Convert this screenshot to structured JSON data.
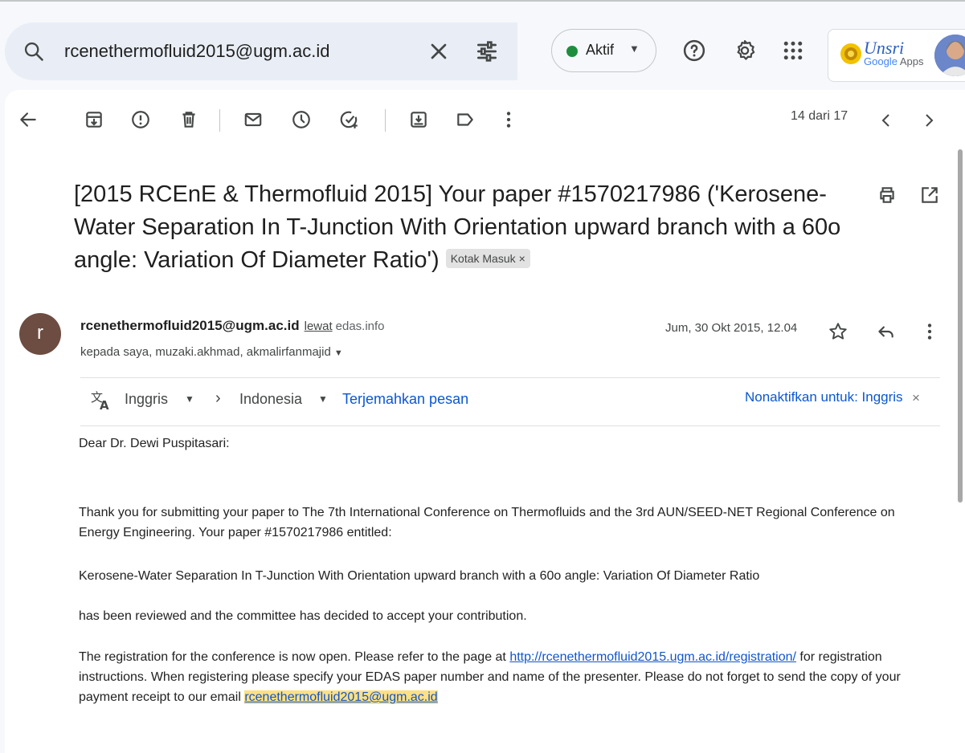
{
  "search": {
    "query": "rcenethermofluid2015@ugm.ac.id"
  },
  "status": {
    "label": "Aktif",
    "color": "#1e8e3e"
  },
  "header_icons": [
    "help-icon",
    "settings-icon",
    "apps-grid-icon"
  ],
  "org_logo": {
    "text": "Unsri",
    "sub_google": "Google",
    "sub_apps": "Apps"
  },
  "toolbar": {
    "icons": [
      "back-arrow-icon",
      "archive-icon",
      "report-spam-icon",
      "delete-icon",
      "mark-unread-icon",
      "snooze-icon",
      "add-task-icon",
      "move-to-icon",
      "label-icon",
      "more-vert-icon"
    ],
    "counter": "14 dari 17"
  },
  "email": {
    "subject": "[2015 RCEnE & Thermofluid 2015] Your paper #1570217986 ('Kerosene-Water Separation In T-Junction With Orientation upward branch with a 60o angle: Variation Of Diameter Ratio')",
    "label_chip": "Kotak Masuk",
    "sender_initial": "r",
    "sender": "rcenethermofluid2015@ugm.ac.id",
    "via": "lewat",
    "via_domain": "edas.info",
    "recipients": "kepada saya, muzaki.akhmad, akmalirfanmajid",
    "date": "Jum, 30 Okt 2015, 12.04"
  },
  "translate": {
    "from_lang": "Inggris",
    "to_lang": "Indonesia",
    "action": "Terjemahkan pesan",
    "turn_off": "Nonaktifkan untuk: Inggris"
  },
  "body": {
    "greeting": "Dear Dr. Dewi Puspitasari:",
    "para1": "Thank you for submitting your paper to The 7th International Conference on Thermofluids and the 3rd AUN/SEED-NET Regional Conference on Energy Engineering. Your paper #1570217986 entitled:",
    "title": "Kerosene-Water Separation In T-Junction With Orientation upward branch with a 60o angle: Variation Of Diameter Ratio",
    "para2": "has been reviewed and the committee has decided to accept your contribution.",
    "para3_before": "The registration for the conference is now open. Please refer to the page at ",
    "para3_link": "http://rcenethermofluid2015.ugm.ac.id/registration/",
    "para3_after": " for registration instructions. When registering please specify your EDAS paper number and name of the presenter. Please do not forget to send the copy of your payment receipt to our email ",
    "para3_email": "rcenethermofluid2015@ugm.ac.id"
  }
}
